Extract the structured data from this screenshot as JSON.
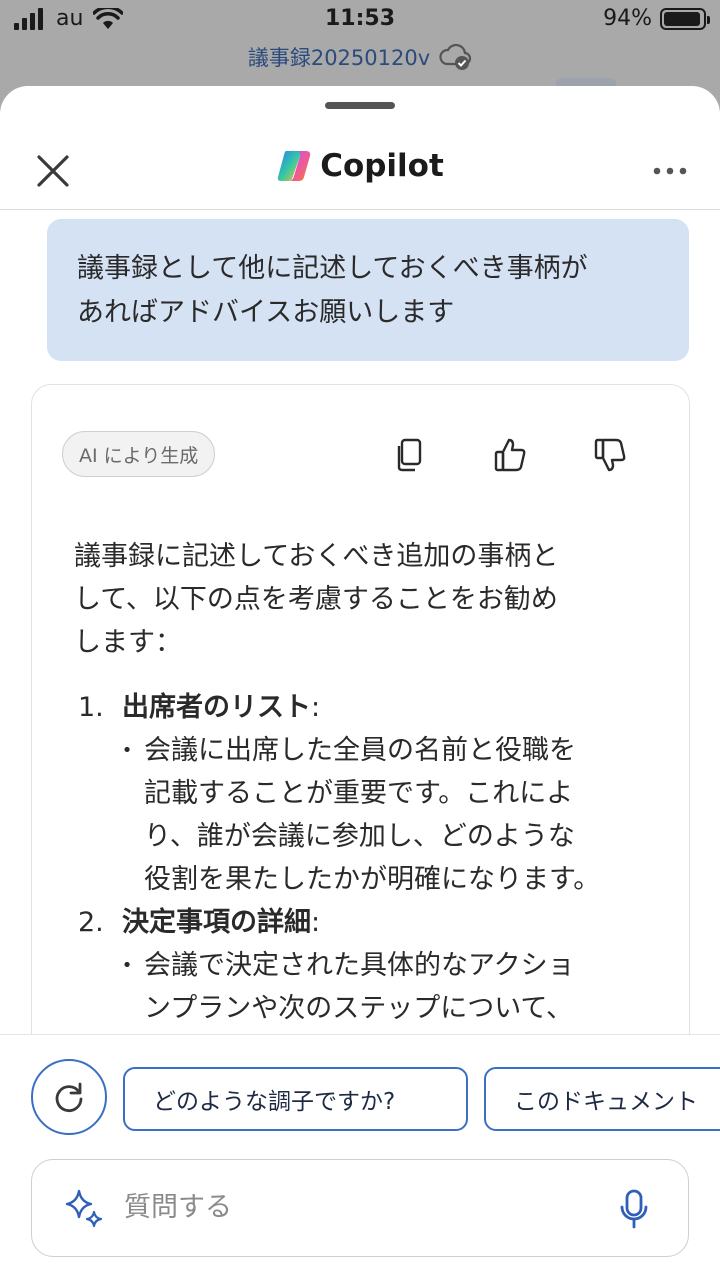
{
  "status_bar": {
    "carrier": "au",
    "time": "11:53",
    "battery": "94%",
    "battery_level": 0.94
  },
  "document": {
    "title": "議事録20250120v"
  },
  "header": {
    "title": "Copilot"
  },
  "conversation": {
    "user_message": [
      "議事録として他に記述しておくべき事柄が",
      "あればアドバイスお願いします"
    ],
    "ai_badge": "AI により生成",
    "intro": [
      "議事録に記述しておくべき追加の事柄と",
      "して、以下の点を考慮することをお勧め",
      "します："
    ],
    "items": [
      {
        "number": "1.",
        "title": "出席者のリスト",
        "suffix": ":",
        "bullets": [
          [
            "会議に出席した全員の名前と役職を",
            "記載することが重要です。これによ",
            "り、誰が会議に参加し、どのような",
            "役割を果たしたかが明確になります。"
          ]
        ]
      },
      {
        "number": "2.",
        "title": "決定事項の詳細",
        "suffix": ":",
        "bullets": [
          [
            "会議で決定された具体的なアクショ",
            "ンプランや次のステップについて、"
          ]
        ]
      }
    ]
  },
  "suggestions": [
    "どのような調子ですか?",
    "このドキュメント"
  ],
  "composer": {
    "placeholder": "質問する",
    "value": ""
  },
  "colors": {
    "accent": "#3a6fc4",
    "user_bubble": "#d5e2f4"
  }
}
